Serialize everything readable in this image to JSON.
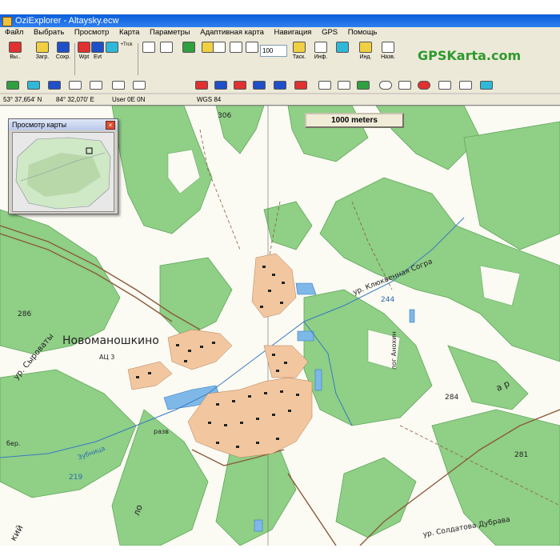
{
  "window": {
    "title": "OziExplorer - Altaysky.ecw"
  },
  "menu": [
    "Файл",
    "Выбрать",
    "Просмотр",
    "Карта",
    "Параметры",
    "Адаптивная карта",
    "Навигация",
    "GPS",
    "Помощь"
  ],
  "toolbar": {
    "exit_label": "Вы..",
    "load_label": "Загр.",
    "save_label": "Сохр.",
    "wpt_label": "Wpt",
    "evt_label": "Evt",
    "trk_label": "+Trck",
    "zoom_value": "100",
    "task_label": "Таск.",
    "info_label": "Инф.",
    "ind_label": "Инд.",
    "name_label": "Назв.",
    "zoom_buttons": [
      "ZOOM 300",
      "ZOOM 100",
      "ZOOM 50",
      "ZOOM FULL",
      "ZOOM 200",
      "ZOOM 100"
    ]
  },
  "brand": "GPSKarta.com",
  "status": {
    "lat": "53° 37,654' N",
    "lon": "84° 32,070' E",
    "user": "User  0E  0N",
    "datum": "WGS 84"
  },
  "map": {
    "scale_label": "1000 meters",
    "village_name": "Новоманошкино",
    "labels": {
      "h306": "306",
      "h286": "286",
      "h244": "244",
      "h284": "284",
      "h281": "281",
      "h219": "219",
      "atc": "АЦ 3",
      "bridge": "разв",
      "ber": "бер.",
      "klyuk": "ур. Клюквенная Согра",
      "syrob": "ур. Сыроваты",
      "zubn": "Зубница",
      "anokhin": "лог Анохин",
      "soldat": "ур. Солдатова Дубрава",
      "kiy": "кий",
      "ap": "а р",
      "lo": "ло"
    }
  },
  "overview": {
    "title": "Просмотр карты"
  },
  "colors": {
    "forest": "#8fcf86",
    "forest_dark": "#6fbe6a",
    "water": "#7db8e8",
    "road": "#8a5a3a",
    "built": "#f2c7a0"
  }
}
